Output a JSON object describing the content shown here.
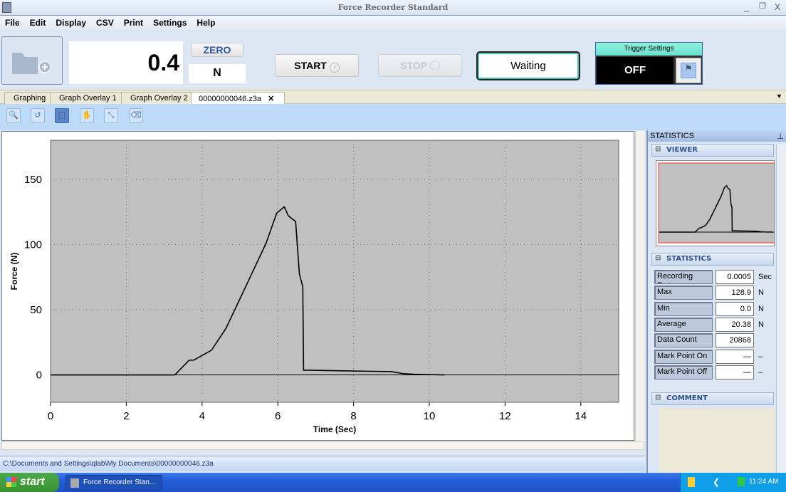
{
  "window": {
    "title": "Force Recorder Standard",
    "minimize": "_",
    "restore": "❐",
    "close": "X"
  },
  "menu": [
    "File",
    "Edit",
    "Display",
    "CSV",
    "Print",
    "Settings",
    "Help"
  ],
  "toolbar": {
    "reading": "0.4",
    "zero_label": "ZERO",
    "unit": "N",
    "start_label": "START",
    "stop_label": "STOP",
    "status": "Waiting",
    "trigger_title": "Trigger Settings",
    "trigger_state": "OFF"
  },
  "tabs": [
    {
      "label": "Graphing"
    },
    {
      "label": "Graph Overlay 1"
    },
    {
      "label": "Graph Overlay 2"
    },
    {
      "label": "00000000046.z3a",
      "active": true,
      "close": "✕"
    }
  ],
  "graph_tools": [
    "zoom-100-icon",
    "undo-icon",
    "select-region-icon",
    "pan-hand-icon",
    "auto-scale-icon",
    "clear-icon"
  ],
  "chart_data": {
    "type": "line",
    "xlabel": "Time (Sec)",
    "ylabel": "Force (N)",
    "xlim": [
      0,
      15
    ],
    "ylim": [
      -21,
      180
    ],
    "xticks": [
      0,
      2,
      4,
      6,
      8,
      10,
      12,
      14
    ],
    "yticks": [
      0,
      50,
      100,
      150
    ],
    "grid": true,
    "grid_style": "dotted",
    "background": "#c0c0c0",
    "line_color": "#000000",
    "series": [
      {
        "x": [
          0,
          3.28,
          3.66,
          3.78,
          4.25,
          4.63,
          4.97,
          5.31,
          5.69,
          5.97,
          6.17,
          6.28,
          6.47,
          6.57,
          6.66,
          6.68,
          6.8,
          8.0,
          9.0,
          9.3,
          9.6,
          10.4
        ],
        "y": [
          0,
          0,
          11.3,
          11.3,
          19,
          35.6,
          56.5,
          77.5,
          101,
          124,
          129,
          122,
          117.7,
          77.5,
          67.5,
          3.6,
          3.6,
          3,
          2.5,
          1,
          0.5,
          0
        ]
      }
    ]
  },
  "side_panel": {
    "title": "STATISTICS",
    "pin": "⊥",
    "viewer_header": "VIEWER",
    "stats_header": "STATISTICS",
    "comment_header": "COMMENT",
    "stats": [
      {
        "label": "Recording Rate",
        "value": "0.0005",
        "unit": "Sec"
      },
      {
        "label": "Max",
        "value": "128.9",
        "unit": "N"
      },
      {
        "label": "Min",
        "value": "0.0",
        "unit": "N"
      },
      {
        "label": "Average",
        "value": "20.38",
        "unit": "N"
      },
      {
        "label": "Data Count",
        "value": "20868",
        "unit": ""
      },
      {
        "label": "Mark Point On",
        "value": "—",
        "unit": "–"
      },
      {
        "label": "Mark Point Off",
        "value": "—",
        "unit": "–"
      }
    ]
  },
  "status_bar": {
    "path": "C:\\Documents and Settings\\qlab\\My Documents\\00000000046.z3a"
  },
  "taskbar": {
    "start_label": "start",
    "task": "Force Recorder Stan...",
    "clock": "11:24 AM"
  }
}
